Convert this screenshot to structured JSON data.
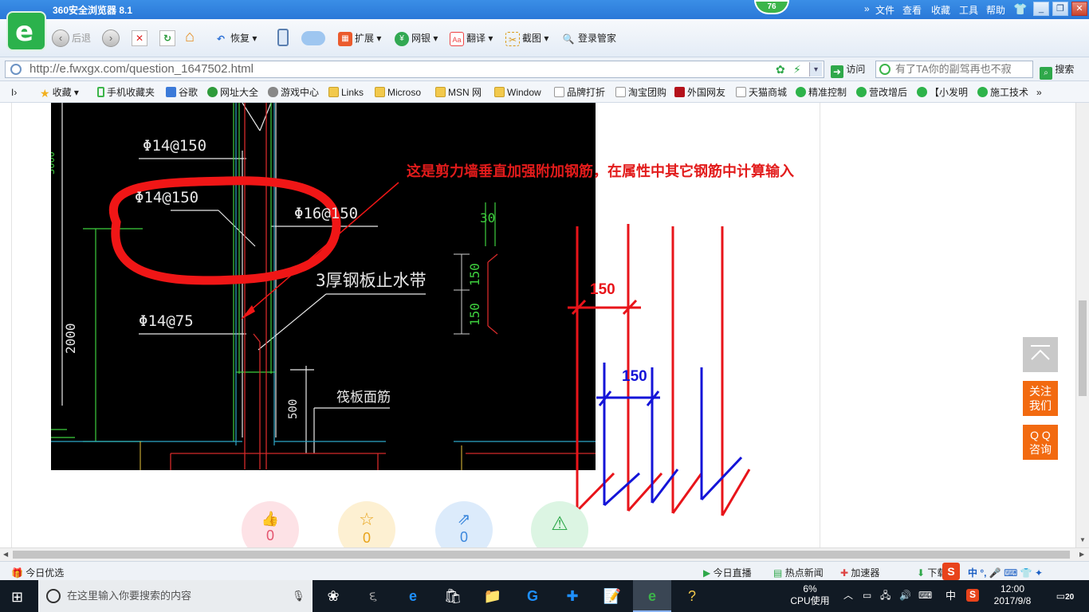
{
  "browser": {
    "title": "360安全浏览器 8.1",
    "badge": "76",
    "menu": [
      "文件",
      "查看",
      "收藏",
      "工具",
      "帮助"
    ]
  },
  "toolbar": {
    "back": "后退",
    "restore": "恢复",
    "extend": "扩展",
    "bank": "网银",
    "translate": "翻译",
    "screenshot": "截图",
    "login": "登录管家"
  },
  "address": {
    "url": "http://e.fwxgx.com/question_1647502.html",
    "visit": "访问",
    "search_text": "有了TA你的副驾再也不寂",
    "search_btn": "搜索"
  },
  "bookmarks": [
    {
      "label": "收藏",
      "icon": "star-icon"
    },
    {
      "label": "手机收藏夹",
      "icon": "phone-icon"
    },
    {
      "label": "谷歌",
      "icon": "google-icon"
    },
    {
      "label": "网址大全",
      "icon": "plus-icon"
    },
    {
      "label": "游戏中心",
      "icon": "gamepad-icon"
    },
    {
      "label": "Links",
      "icon": "folder-icon"
    },
    {
      "label": "Microso",
      "icon": "folder-icon"
    },
    {
      "label": "MSN 网",
      "icon": "folder-icon"
    },
    {
      "label": "Window",
      "icon": "folder-icon"
    },
    {
      "label": "品牌打折",
      "icon": "page-icon"
    },
    {
      "label": "淘宝团购",
      "icon": "page-icon"
    },
    {
      "label": "外国网友",
      "icon": "flag-icon"
    },
    {
      "label": "天猫商城",
      "icon": "page-icon"
    },
    {
      "label": "精准控制",
      "icon": "wechat-icon"
    },
    {
      "label": "营改增后",
      "icon": "wechat-icon"
    },
    {
      "label": "【小发明",
      "icon": "wechat-icon"
    },
    {
      "label": "施工技术",
      "icon": "wechat-icon"
    }
  ],
  "drawing": {
    "labels": [
      "Φ14@150",
      "Φ14@150",
      "Φ16@150",
      "Φ14@75",
      "3厚钢板止水带",
      "筏板面筋",
      "2000",
      "500",
      "150",
      "150",
      "30",
      "3000"
    ],
    "annotation": "这是剪力墙垂直加强附加钢筋，在属性中其它钢筋中计算输入",
    "dim_red": "150",
    "dim_blue": "150",
    "colors": {
      "annotation": "#e21b1b",
      "rebar_red": "#e8141a",
      "rebar_blue": "#1414d8",
      "cad_bg": "#000000"
    }
  },
  "floating": {
    "top_label": "",
    "follow": "关注\n我们",
    "qq": "Q Q\n咨询",
    "accent": "#f26a10"
  },
  "actions": [
    {
      "count": "0",
      "icon": "thumbs-up-icon",
      "color": "#fde2e6"
    },
    {
      "count": "0",
      "icon": "star-icon",
      "color": "#fdf0d2"
    },
    {
      "count": "0",
      "icon": "share-icon",
      "color": "#dcebfb"
    },
    {
      "count": "",
      "icon": "warning-icon",
      "color": "#dcf5e3"
    }
  ],
  "status": {
    "left": "今日优选",
    "live": "今日直播",
    "news": "热点新闻",
    "speed": "加速器",
    "download": "下载"
  },
  "taskbar": {
    "search_placeholder": "在这里输入你要搜索的内容",
    "cpu_pct": "6%",
    "cpu_label": "CPU使用",
    "ime": "中",
    "time": "12:00",
    "date": "2017/9/8",
    "notifications": "20"
  }
}
